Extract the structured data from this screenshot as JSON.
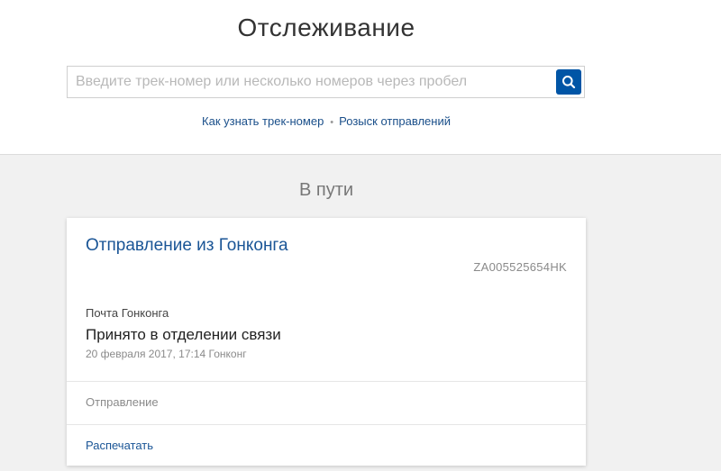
{
  "header": {
    "title": "Отслеживание"
  },
  "search": {
    "placeholder": "Введите трек-номер или несколько номеров через пробел",
    "value": "",
    "button_icon": "search-icon"
  },
  "links": {
    "how_to_find": "Как узнать трек-номер",
    "separator": "•",
    "search_parcels": "Розыск отправлений"
  },
  "section": {
    "title": "В пути"
  },
  "shipment": {
    "title": "Отправление из Гонконга",
    "track_number": "ZA005525654HK",
    "carrier": "Почта Гонконга",
    "status": "Принято в отделении связи",
    "status_meta": "20 февраля 2017, 17:14 Гонконг",
    "details_label": "Отправление",
    "print_label": "Распечатать"
  },
  "colors": {
    "accent": "#0055a6",
    "link": "#1a5596",
    "background": "#f1f1f1"
  }
}
